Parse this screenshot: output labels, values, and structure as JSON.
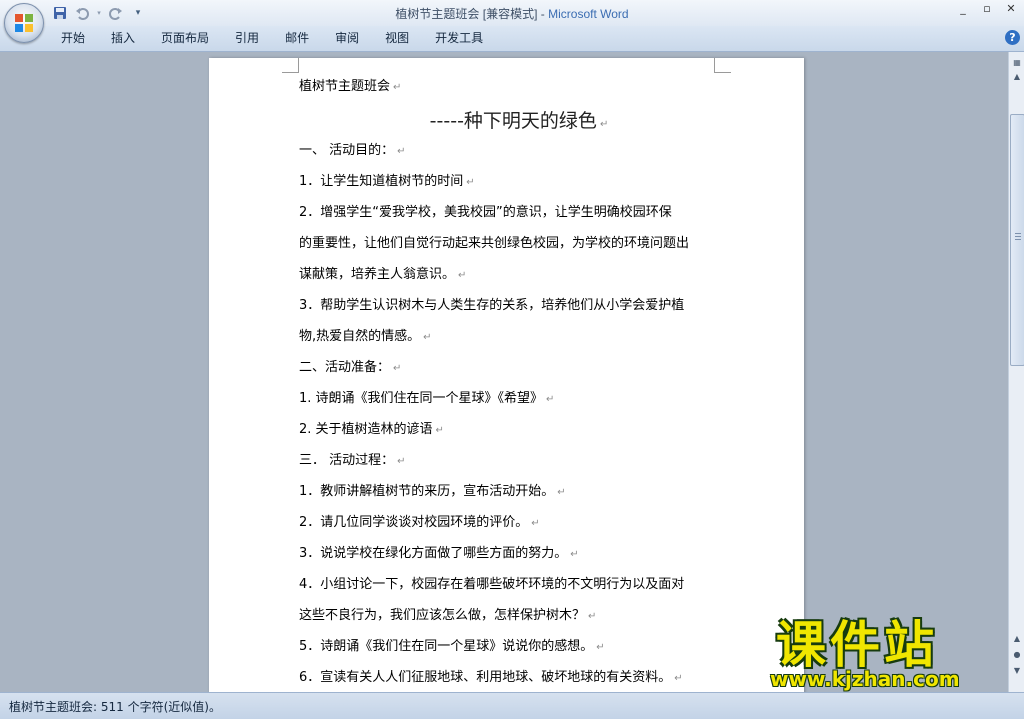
{
  "window": {
    "title_doc": "植树节主题班会 [兼容模式]",
    "title_sep": " - ",
    "title_app": "Microsoft Word",
    "controls": [
      "_",
      "▫",
      "✕"
    ]
  },
  "qat": {
    "save_icon": "save-icon",
    "undo_icon": "undo-icon",
    "redo_icon": "redo-icon",
    "customize_icon": "customize-icon"
  },
  "ribbon": {
    "tabs": [
      "开始",
      "插入",
      "页面布局",
      "引用",
      "邮件",
      "审阅",
      "视图",
      "开发工具"
    ],
    "help": "?"
  },
  "document": {
    "paragraphs": [
      "植树节主题班会",
      "-----种下明天的绿色",
      "一、 活动目的：",
      "1．让学生知道植树节的时间",
      "2．增强学生“爱我学校，美我校园”的意识，让学生明确校园环保",
      "的重要性，让他们自觉行动起来共创绿色校园，为学校的环境问题出",
      "谋献策，培养主人翁意识。",
      "3．帮助学生认识树木与人类生存的关系，培养他们从小学会爱护植",
      "物,热爱自然的情感。",
      "二、活动准备：",
      "1. 诗朗诵《我们住在同一个星球》《希望》",
      "2. 关于植树造林的谚语",
      "三． 活动过程：",
      "1．教师讲解植树节的来历，宣布活动开始。",
      "2．请几位同学谈谈对校园环境的评价。",
      "3．说说学校在绿化方面做了哪些方面的努力。",
      "4．小组讨论一下，校园存在着哪些破坏环境的不文明行为以及面对",
      "这些不良行为，我们应该怎么做，怎样保护树木？",
      "5．诗朗诵《我们住在同一个星球》说说你的感想。",
      "6．宣读有关人人们征服地球、利用地球、破坏地球的有关资料。"
    ],
    "mark": "↵"
  },
  "statusbar": {
    "text": "植树节主题班会: 511 个字符(近似值)。"
  },
  "watermark": {
    "big": "课件站",
    "small": "www.kjzhan.com"
  }
}
